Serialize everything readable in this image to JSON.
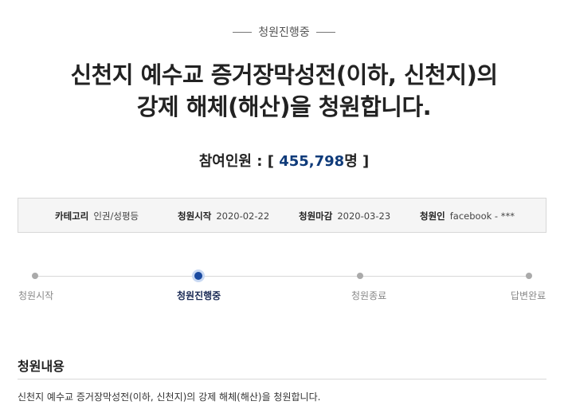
{
  "status_header": "청원진행중",
  "title": {
    "line1": "신천지 예수교 증거장막성전(이하, 신천지)의",
    "line2": "강제 해체(해산)을 청원합니다."
  },
  "participants": {
    "label": "참여인원 : [ ",
    "count": "455,798",
    "unit": "명",
    "close": " ]"
  },
  "info": {
    "category_label": "카테고리",
    "category_value": "인권/성평등",
    "start_label": "청원시작",
    "start_value": "2020-02-22",
    "end_label": "청원마감",
    "end_value": "2020-03-23",
    "author_label": "청원인",
    "author_value": "facebook - ***"
  },
  "progress": {
    "steps": [
      "청원시작",
      "청원진행중",
      "청원종료",
      "답변완료"
    ],
    "active_index": 1
  },
  "content": {
    "heading": "청원내용",
    "body": "신천지 예수교 증거장막성전(이하, 신천지)의 강제 해체(해산)을 청원합니다."
  },
  "colors": {
    "accent": "#1a4aa0",
    "count": "#0f3b7a"
  }
}
